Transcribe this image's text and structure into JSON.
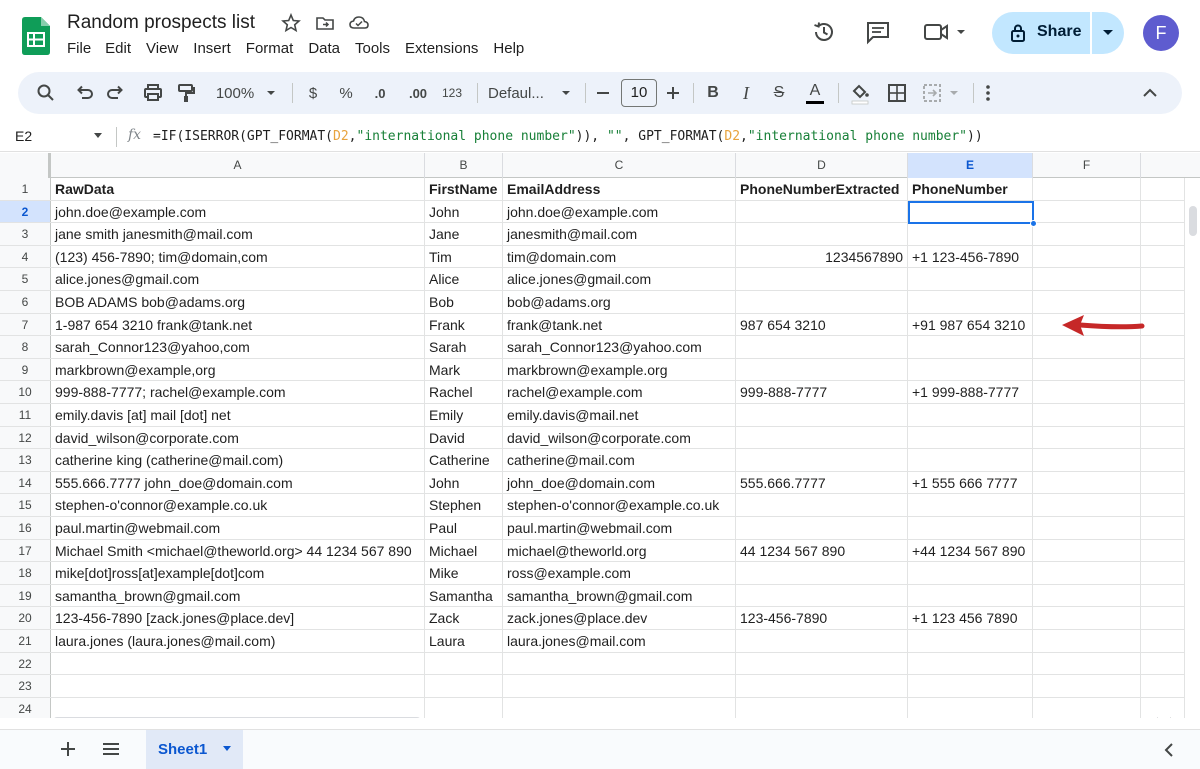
{
  "app": {
    "doc_title": "Random prospects list",
    "menu": [
      "File",
      "Edit",
      "View",
      "Insert",
      "Format",
      "Data",
      "Tools",
      "Extensions",
      "Help"
    ],
    "share_label": "Share",
    "avatar_letter": "F"
  },
  "toolbar": {
    "zoom": "100%",
    "currency": "$",
    "percent": "%",
    "dec_decrease": ".0",
    "dec_increase": ".00",
    "number_format": "123",
    "font": "Defaul...",
    "font_size": "10",
    "bold": "B",
    "italic": "I",
    "strike": "S",
    "text_color": "A"
  },
  "formula_bar": {
    "name_box": "E2",
    "fx": "fx",
    "formula_parts": [
      {
        "t": "=IF(ISERROR(GPT_FORMAT(",
        "c": ""
      },
      {
        "t": "D2",
        "c": "ref"
      },
      {
        "t": ",",
        "c": ""
      },
      {
        "t": "\"international phone number\"",
        "c": "str"
      },
      {
        "t": ")), ",
        "c": ""
      },
      {
        "t": "\"\"",
        "c": "str"
      },
      {
        "t": ", GPT_FORMAT(",
        "c": ""
      },
      {
        "t": "D2",
        "c": "ref"
      },
      {
        "t": ",",
        "c": ""
      },
      {
        "t": "\"international phone number\"",
        "c": "str"
      },
      {
        "t": "))",
        "c": ""
      }
    ]
  },
  "grid": {
    "columns": [
      "A",
      "B",
      "C",
      "D",
      "E",
      "F"
    ],
    "selected_column": "E",
    "selected_row": "2",
    "rows": [
      {
        "n": "1",
        "cells": [
          "RawData",
          "FirstName",
          "EmailAddress",
          "PhoneNumberExtracted",
          "PhoneNumber",
          ""
        ]
      },
      {
        "n": "2",
        "cells": [
          "john.doe@example.com",
          "John",
          "john.doe@example.com",
          "",
          "",
          ""
        ]
      },
      {
        "n": "3",
        "cells": [
          "jane smith janesmith@mail.com",
          "Jane",
          "janesmith@mail.com",
          "",
          "",
          ""
        ]
      },
      {
        "n": "4",
        "cells": [
          "(123) 456-7890; tim@domain,com",
          "Tim",
          "tim@domain.com",
          "1234567890",
          "+1 123-456-7890",
          ""
        ]
      },
      {
        "n": "5",
        "cells": [
          "alice.jones@gmail.com",
          "Alice",
          "alice.jones@gmail.com",
          "",
          "",
          ""
        ]
      },
      {
        "n": "6",
        "cells": [
          "BOB ADAMS bob@adams.org",
          "Bob",
          "bob@adams.org",
          "",
          "",
          ""
        ]
      },
      {
        "n": "7",
        "cells": [
          "1-987 654 3210 frank@tank.net",
          "Frank",
          "frank@tank.net",
          "987 654 3210",
          "+91 987 654 3210",
          ""
        ]
      },
      {
        "n": "8",
        "cells": [
          "sarah_Connor123@yahoo,com",
          "Sarah",
          "sarah_Connor123@yahoo.com",
          "",
          "",
          ""
        ]
      },
      {
        "n": "9",
        "cells": [
          "markbrown@example,org",
          "Mark",
          "markbrown@example.org",
          "",
          "",
          ""
        ]
      },
      {
        "n": "10",
        "cells": [
          "999-888-7777; rachel@example.com",
          "Rachel",
          "rachel@example.com",
          "999-888-7777",
          "+1 999-888-7777",
          ""
        ]
      },
      {
        "n": "11",
        "cells": [
          "emily.davis [at] mail [dot] net",
          "Emily",
          "emily.davis@mail.net",
          "",
          "",
          ""
        ]
      },
      {
        "n": "12",
        "cells": [
          "david_wilson@corporate.com",
          "David",
          "david_wilson@corporate.com",
          "",
          "",
          ""
        ]
      },
      {
        "n": "13",
        "cells": [
          "catherine king (catherine@mail.com)",
          "Catherine",
          "catherine@mail.com",
          "",
          "",
          ""
        ]
      },
      {
        "n": "14",
        "cells": [
          "555.666.7777 john_doe@domain.com",
          "John",
          "john_doe@domain.com",
          "555.666.7777",
          "+1 555 666 7777",
          ""
        ]
      },
      {
        "n": "15",
        "cells": [
          "stephen-o'connor@example.co.uk",
          "Stephen",
          "stephen-o'connor@example.co.uk",
          "",
          "",
          ""
        ]
      },
      {
        "n": "16",
        "cells": [
          "paul.martin@webmail.com",
          "Paul",
          "paul.martin@webmail.com",
          "",
          "",
          ""
        ]
      },
      {
        "n": "17",
        "cells": [
          "Michael Smith <michael@theworld.org> 44 1234 567 890",
          "Michael",
          "michael@theworld.org",
          "44 1234 567 890",
          "+44 1234 567 890",
          ""
        ]
      },
      {
        "n": "18",
        "cells": [
          "mike[dot]ross[at]example[dot]com",
          "Mike",
          "ross@example.com",
          "",
          "",
          ""
        ]
      },
      {
        "n": "19",
        "cells": [
          "samantha_brown@gmail.com",
          "Samantha",
          "samantha_brown@gmail.com",
          "",
          "",
          ""
        ]
      },
      {
        "n": "20",
        "cells": [
          "123-456-7890 [zack.jones@place.dev]",
          "Zack",
          "zack.jones@place.dev",
          "123-456-7890",
          "+1 123 456 7890",
          ""
        ]
      },
      {
        "n": "21",
        "cells": [
          "laura.jones (laura.jones@mail.com)",
          "Laura",
          "laura.jones@mail.com",
          "",
          "",
          ""
        ]
      },
      {
        "n": "22",
        "cells": [
          "",
          "",
          "",
          "",
          "",
          ""
        ]
      },
      {
        "n": "23",
        "cells": [
          "",
          "",
          "",
          "",
          "",
          ""
        ]
      },
      {
        "n": "24",
        "cells": [
          "",
          "",
          "",
          "",
          "",
          ""
        ]
      }
    ],
    "numeric_cells": [
      {
        "row": "4",
        "col": 3
      }
    ]
  },
  "sheets": {
    "active": "Sheet1"
  },
  "colors": {
    "accent": "#0b57d0",
    "selection": "#1a73e8",
    "share_bg": "#c2e7ff",
    "annotation_arrow": "#c62828"
  }
}
